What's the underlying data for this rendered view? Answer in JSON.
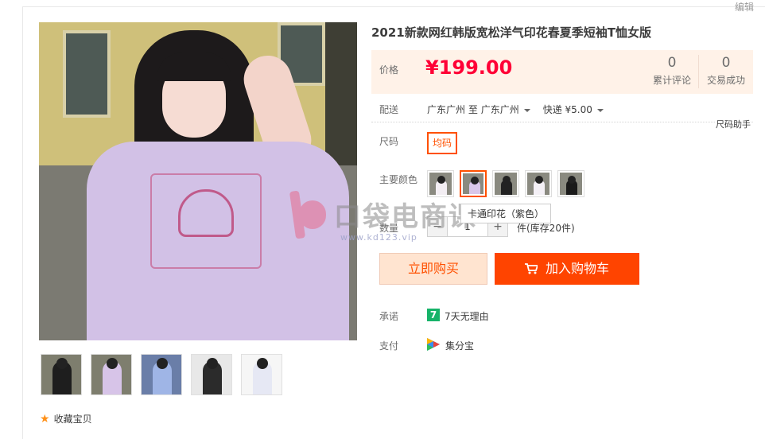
{
  "header": {
    "edit_label": "编辑"
  },
  "product": {
    "title": "2021新款网红韩版宽松洋气印花春夏季短袖T恤女版",
    "price_label": "价格",
    "price": "¥199.00",
    "reviews_count": "0",
    "reviews_label": "累计评论",
    "sales_count": "0",
    "sales_label": "交易成功"
  },
  "shipping": {
    "label": "配送",
    "from": "广东广州",
    "to_word": "至",
    "to": "广东广州",
    "method": "快递 ¥5.00"
  },
  "size": {
    "label": "尺码",
    "helper": "尺码助手",
    "options": [
      "均码"
    ],
    "selected": "均码"
  },
  "color": {
    "label": "主要颜色",
    "selected_index": 1,
    "tooltip": "卡通印花（紫色）",
    "swatch_colors": [
      "#f3eef3",
      "#d9c7ea",
      "#222222",
      "#f4f0f6",
      "#1a1a1a"
    ]
  },
  "quantity": {
    "label": "数量",
    "value": "1",
    "minus": "−",
    "plus": "+",
    "unit_stock": "件(库存20件)"
  },
  "actions": {
    "buy_now": "立即购买",
    "add_to_cart": "加入购物车"
  },
  "promise": {
    "label": "承诺",
    "icon_text": "7",
    "text": "7天无理由"
  },
  "payment": {
    "label": "支付",
    "text": "集分宝"
  },
  "favorite": {
    "label": "收藏宝贝"
  },
  "watermark": {
    "text": "口袋电商课",
    "url": "www.kd123.vip"
  },
  "thumbnails": [
    {
      "shirt": "#1e1e1e",
      "bg": "#7e7e6e"
    },
    {
      "shirt": "#d7c4e8",
      "bg": "#7e7e6e"
    },
    {
      "shirt": "#9fb5e6",
      "bg": "#6a7ea8"
    },
    {
      "shirt": "#2b2b2b",
      "bg": "#e8e8e8"
    },
    {
      "shirt": "#e6e8f4",
      "bg": "#f6f6f6"
    }
  ],
  "colors": {
    "accent": "#ff5000",
    "price": "#ff0036",
    "cart_button": "#ff4400",
    "price_bg": "#fff2e8"
  }
}
